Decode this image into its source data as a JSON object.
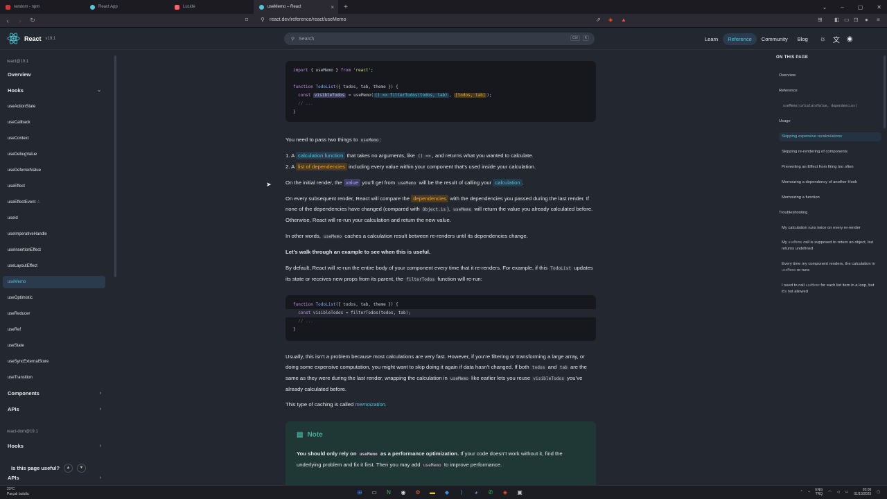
{
  "browser": {
    "tabs": [
      {
        "label": "random - npm",
        "color": "#cb3837"
      },
      {
        "label": "React App",
        "color": "#58c4dc"
      },
      {
        "label": "Lucide",
        "color": "#f56565"
      },
      {
        "label": "useMemo – React",
        "color": "#58c4dc",
        "active": true
      }
    ],
    "url": "react.dev/reference/react/useMemo"
  },
  "header": {
    "brand": "React",
    "version": "v19.1",
    "search_placeholder": "Search",
    "kbd_ctrl": "Ctrl",
    "kbd_k": "K",
    "nav": [
      "Learn",
      "Reference",
      "Community",
      "Blog"
    ],
    "active_nav": "Reference"
  },
  "sidebar": {
    "pkg1": "react@19.1",
    "overview": "Overview",
    "hooks": "Hooks",
    "items": [
      "useActionState",
      "useCallback",
      "useContext",
      "useDebugValue",
      "useDeferredValue",
      "useEffect",
      "useEffectEvent",
      "useId",
      "useImperativeHandle",
      "useInsertionEffect",
      "useLayoutEffect",
      "useMemo",
      "useOptimistic",
      "useReducer",
      "useRef",
      "useState",
      "useSyncExternalStore",
      "useTransition"
    ],
    "components": "Components",
    "apis": "APIs",
    "pkg2": "react-dom@19.1",
    "hooks2": "Hooks",
    "apis2": "APIs",
    "useful": "Is this page useful?"
  },
  "content": {
    "code1": {
      "l1a": "import",
      "l1b": "{ useMemo }",
      "l1c": "from",
      "l1d": "'react';",
      "l2a": "function",
      "l2b": "TodoList",
      "l2c": "({ todos, tab, theme }) {",
      "l3a": "const",
      "l3b": "visibleTodos",
      "l3c": "= useMemo(",
      "l3d": "() => filterTodos(todos, tab)",
      "l3e": ",",
      "l3f": "[todos, tab]",
      "l3g": ");",
      "l4": "// ...",
      "l5": "}"
    },
    "p1a": "You need to pass two things to",
    "p1code": "useMemo",
    "p1b": ":",
    "li1a": "1. A",
    "li1b": "calculation function",
    "li1c": "that takes no arguments, like",
    "li1code": "() =>",
    "li1d": ", and returns what you wanted to calculate.",
    "li2a": "2. A",
    "li2b": "list of dependencies",
    "li2c": "including every value within your component that’s used inside your calculation.",
    "p2a": "On the initial render, the",
    "p2b": "value",
    "p2c": "you’ll get from",
    "p2code": "useMemo",
    "p2d": "will be the result of calling your",
    "p2e": "calculation",
    "p2f": ".",
    "p3a": "On every subsequent render, React will compare the",
    "p3b": "dependencies",
    "p3c": "with the dependencies you passed during the last render. If none of the dependencies have changed (compared with",
    "p3code1": "Object.is",
    "p3d": "),",
    "p3code2": "useMemo",
    "p3e": "will return the value you already calculated before. Otherwise, React will re-run your calculation and return the new value.",
    "p4a": "In other words,",
    "p4code": "useMemo",
    "p4b": "caches a calculation result between re-renders until its dependencies change.",
    "p5": "Let’s walk through an example to see when this is useful.",
    "p6a": "By default, React will re-run the entire body of your component every time that it re-renders. For example, if this",
    "p6code1": "TodoList",
    "p6b": "updates its state or receives new props from its parent, the",
    "p6code2": "filterTodos",
    "p6c": "function will re-run:",
    "code2": {
      "l1a": "function",
      "l1b": "TodoList",
      "l1c": "({ todos, tab, theme }) {",
      "l2a": "const",
      "l2b": "visibleTodos",
      "l2c": "= filterTodos(todos, tab);",
      "l3": "// ...",
      "l4": "}"
    },
    "p7a": "Usually, this isn’t a problem because most calculations are very fast. However, if you’re filtering or transforming a large array, or doing some expensive computation, you might want to skip doing it again if data hasn’t changed. If both",
    "p7code1": "todos",
    "p7b": "and",
    "p7code2": "tab",
    "p7c": "are the same as they were during the last render, wrapping the calculation in",
    "p7code3": "useMemo",
    "p7d": "like earlier lets you reuse",
    "p7code4": "visibleTodos",
    "p7e": "you’ve already calculated before.",
    "p8a": "This type of caching is called",
    "p8b": "memoization.",
    "note_title": "Note",
    "note_a": "You should only rely on",
    "note_code1": "useMemo",
    "note_b": "as a performance optimization.",
    "note_c": "If your code doesn’t work without it, find the underlying problem and fix it first. Then you may add",
    "note_code2": "useMemo",
    "note_d": "to improve performance."
  },
  "toc": {
    "heading": "ON THIS PAGE",
    "items": [
      {
        "label": "Overview"
      },
      {
        "label": "Reference"
      },
      {
        "label": "useMemo(calculateValue, dependencies)"
      },
      {
        "label": "Usage"
      },
      {
        "label": "Skipping expensive recalculations",
        "active": true
      },
      {
        "label": "Skipping re-rendering of components"
      },
      {
        "label": "Preventing an Effect from firing too often"
      },
      {
        "label": "Memoizing a dependency of another Hook"
      },
      {
        "label": "Memoizing a function"
      },
      {
        "label": "Troubleshooting"
      },
      {
        "label": "My calculation runs twice on every re-render"
      },
      {
        "label": "call is supposed to return an object, but returns undefined"
      },
      {
        "label": "Every time my component renders, the calculation in useMemo re-runs"
      },
      {
        "label": "I need to call useMemo for each list item in a loop, but it’s not allowed"
      }
    ],
    "my": "My",
    "usememo": "useMemo",
    "re_runs": "re-runs",
    "every_time": "Every time my component renders, the calculation in",
    "need_a": "I need to call",
    "need_b": "for each list item in a loop, but it’s not allowed"
  },
  "taskbar": {
    "temp": "23°C",
    "weather": "Parçalı bulutlu",
    "lang1": "ENG",
    "lang2": "TRQ",
    "time": "20:06",
    "date": "01/10/2025"
  }
}
